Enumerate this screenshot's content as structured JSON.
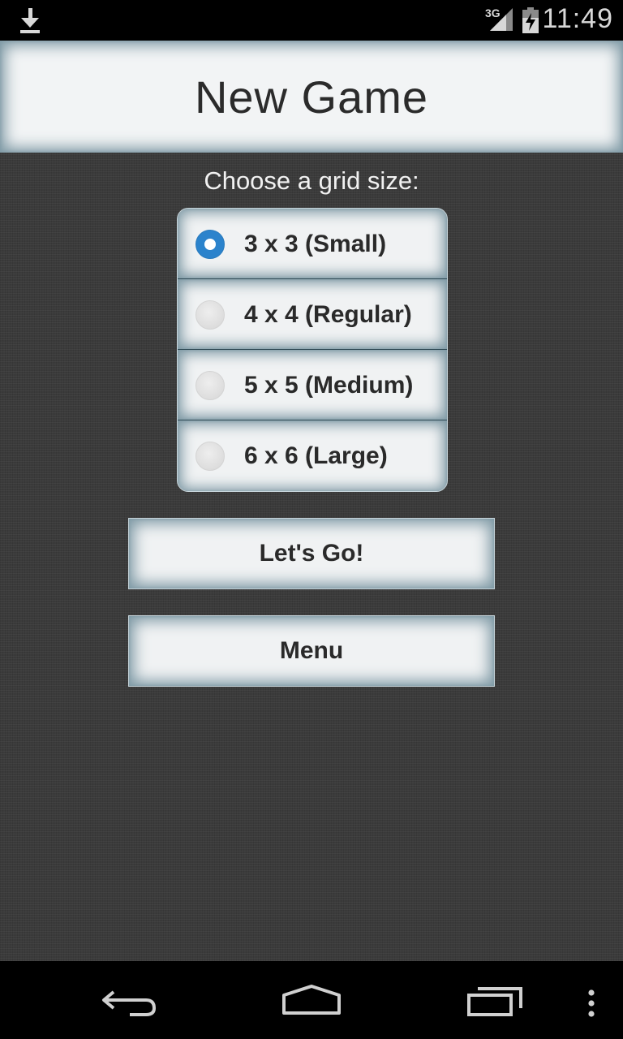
{
  "status_bar": {
    "network": "3G",
    "time": "11:49"
  },
  "header": {
    "title": "New Game"
  },
  "prompt": "Choose a grid size:",
  "grid_options": [
    {
      "label": "3 x 3 (Small)",
      "checked": true
    },
    {
      "label": "4 x 4 (Regular)",
      "checked": false
    },
    {
      "label": "5 x 5 (Medium)",
      "checked": false
    },
    {
      "label": "6 x 6 (Large)",
      "checked": false
    }
  ],
  "buttons": {
    "go_label": "Let's Go!",
    "menu_label": "Menu"
  },
  "colors": {
    "accent": "#2b83cc",
    "frame_glow": "#7d98a4"
  },
  "icons": {
    "status_left": "download-icon",
    "nav_back": "back-icon",
    "nav_home": "home-icon",
    "nav_recents": "recents-icon",
    "nav_overflow": "overflow-menu-icon"
  }
}
